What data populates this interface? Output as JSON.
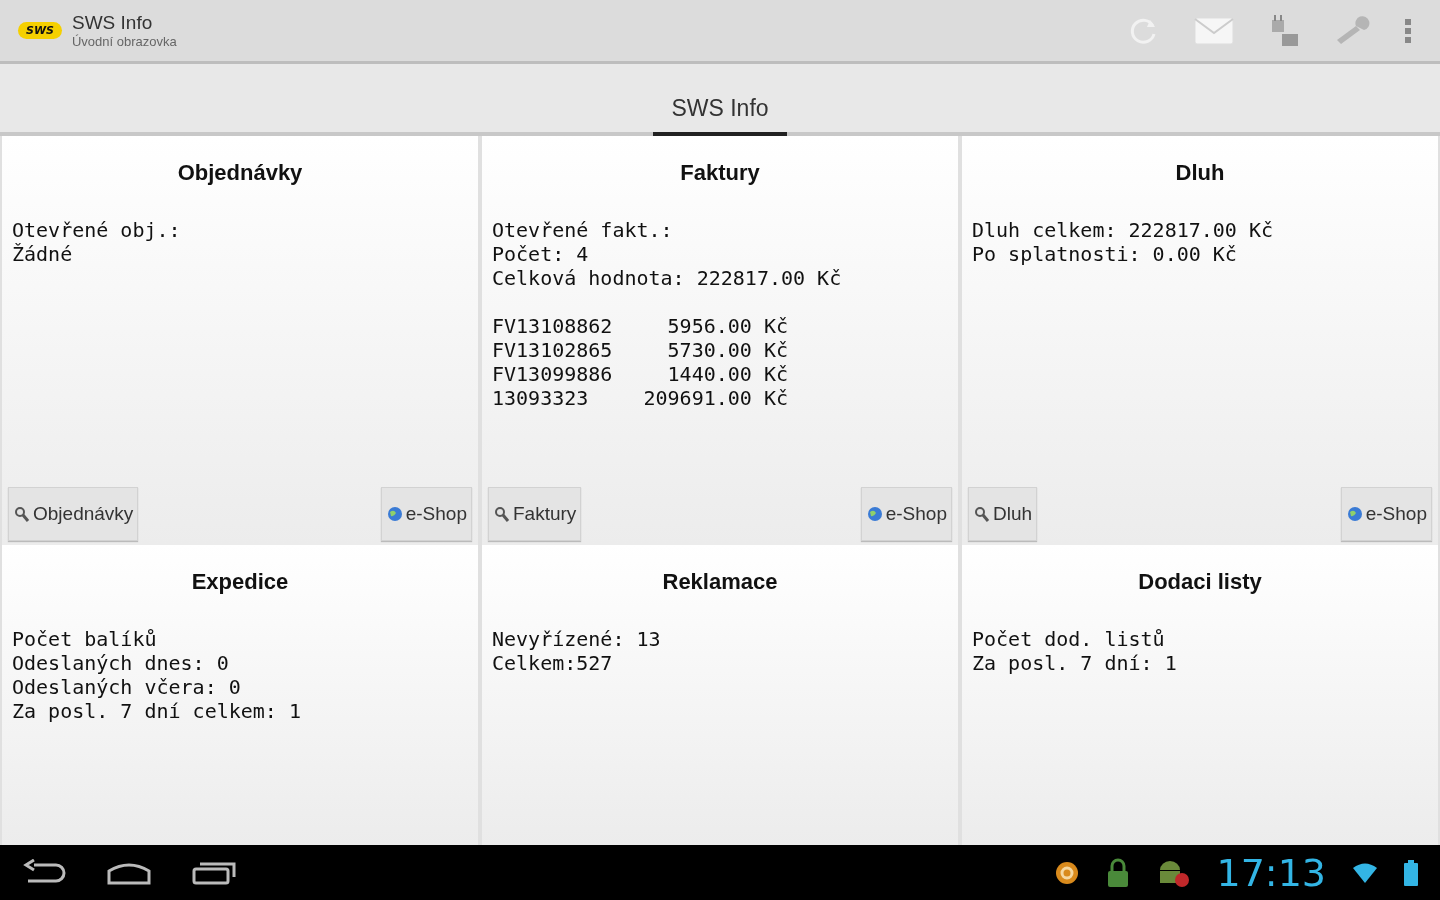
{
  "action_bar": {
    "title": "SWS Info",
    "subtitle": "Úvodní obrazovka",
    "logo": "SWS"
  },
  "tabs": [
    {
      "label": "SWS Info",
      "selected": true
    }
  ],
  "cards": [
    {
      "title": "Objednávky",
      "lines": [
        "Otevřené obj.:",
        "Žádné"
      ],
      "buttons": [
        {
          "label": "Objednávky",
          "kind": "search"
        },
        {
          "label": "e-Shop",
          "kind": "globe"
        }
      ]
    },
    {
      "title": "Faktury",
      "lines": [
        "Otevřené fakt.:",
        "Počet: 4",
        "Celková hodnota: 222817.00 Kč"
      ],
      "invoices": [
        {
          "number": "FV13108862",
          "amount": "5956.00 Kč"
        },
        {
          "number": "FV13102865",
          "amount": "5730.00 Kč"
        },
        {
          "number": "FV13099886",
          "amount": "1440.00 Kč"
        },
        {
          "number": "13093323",
          "amount": "209691.00 Kč"
        }
      ],
      "buttons": [
        {
          "label": "Faktury",
          "kind": "search"
        },
        {
          "label": "e-Shop",
          "kind": "globe"
        }
      ]
    },
    {
      "title": "Dluh",
      "lines": [
        "Dluh celkem: 222817.00 Kč",
        "Po splatnosti: 0.00 Kč"
      ],
      "buttons": [
        {
          "label": "Dluh",
          "kind": "search"
        },
        {
          "label": "e-Shop",
          "kind": "globe"
        }
      ]
    },
    {
      "title": "Expedice",
      "lines": [
        "Počet balíků",
        "Odeslaných dnes: 0",
        "Odeslaných včera: 0",
        "Za posl. 7 dní celkem: 1"
      ]
    },
    {
      "title": "Reklamace",
      "lines": [
        "Nevyřízené: 13",
        "Celkem:527"
      ]
    },
    {
      "title": "Dodaci listy",
      "lines": [
        "Počet dod. listů",
        "Za posl. 7 dní: 1"
      ]
    }
  ],
  "status_bar": {
    "time": "17:13"
  }
}
